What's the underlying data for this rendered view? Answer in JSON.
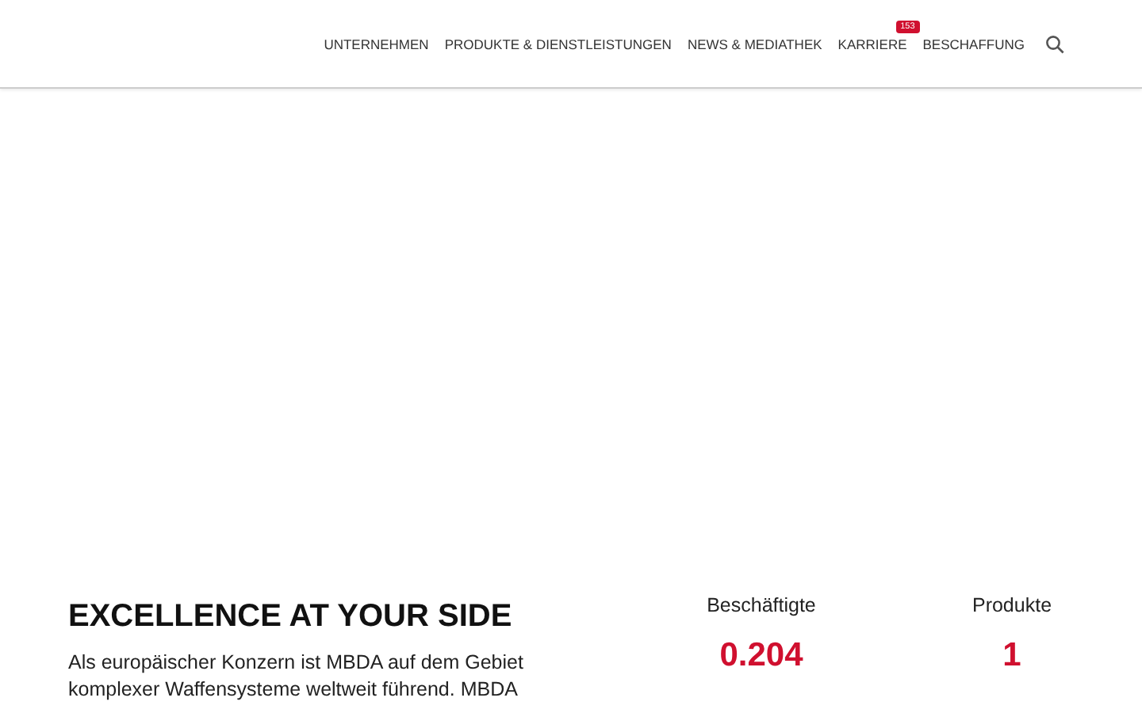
{
  "nav": {
    "items": [
      {
        "label": "UNTERNEHMEN"
      },
      {
        "label": "PRODUKTE & DIENSTLEISTUNGEN"
      },
      {
        "label": "NEWS & MEDIATHEK"
      },
      {
        "label": "KARRIERE",
        "badge": "153"
      },
      {
        "label": "BESCHAFFUNG"
      }
    ]
  },
  "intro": {
    "heading": "EXCELLENCE AT YOUR SIDE",
    "text": "Als europäischer Konzern ist MBDA auf dem Gebiet komplexer Waffensysteme weltweit führend. MBDA"
  },
  "stats": [
    {
      "label": "Beschäftigte",
      "value": "0.204"
    },
    {
      "label": "Produkte",
      "value": "1"
    }
  ]
}
